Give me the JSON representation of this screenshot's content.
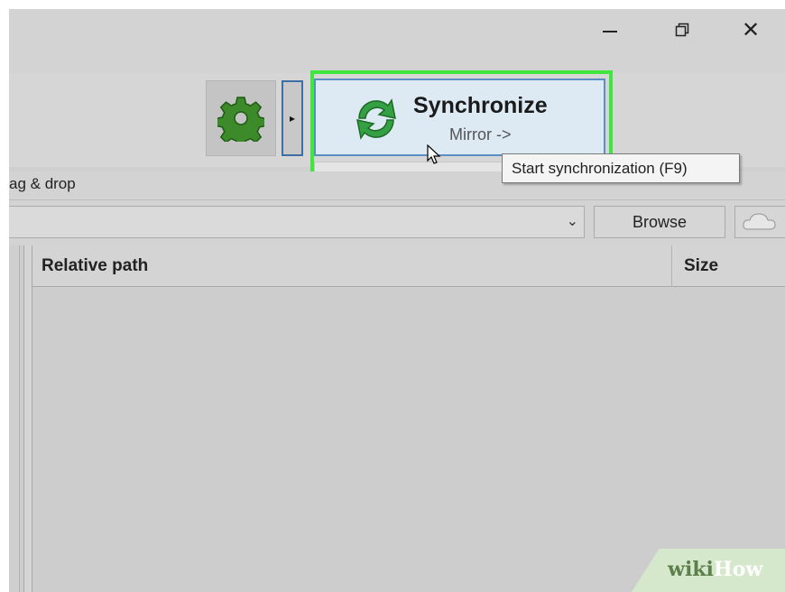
{
  "window": {
    "controls": {
      "minimize_icon": "minimize-icon",
      "restore_icon": "restore-icon",
      "close_icon": "close-icon",
      "close_glyph": "✕"
    }
  },
  "toolbar": {
    "settings_icon": "gear-icon",
    "settings_color": "#3c8a2a",
    "expand_arrow": "▸",
    "sync": {
      "title": "Synchronize",
      "subtitle": "Mirror ->",
      "icon": "sync-arrows-icon",
      "highlight_color": "#3ee63e"
    }
  },
  "tooltip": {
    "text": "Start synchronization (F9)"
  },
  "dragdrop": {
    "label": "ag & drop"
  },
  "folder": {
    "path_value": "",
    "dropdown_glyph": "⌄",
    "browse_label": "Browse",
    "cloud_icon": "cloud-icon"
  },
  "grid": {
    "columns": [
      "Relative path",
      "Size"
    ]
  },
  "watermark": {
    "part1": "wiki",
    "part2": "How"
  }
}
